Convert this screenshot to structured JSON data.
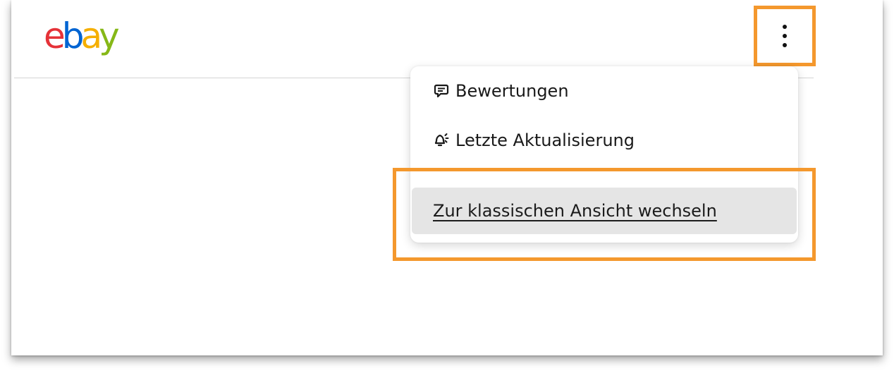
{
  "header": {
    "logo": {
      "letters": [
        "e",
        "b",
        "a",
        "y"
      ],
      "colors": [
        "#e53238",
        "#0064d2",
        "#f5af02",
        "#86b817"
      ]
    },
    "more_button_icon": "kebab-vertical-icon"
  },
  "menu": {
    "items": [
      {
        "label": "Bewertungen",
        "icon": "feedback-speech-icon"
      },
      {
        "label": "Letzte Aktualisierung",
        "icon": "announcement-icon"
      },
      {
        "label": "Zur klassischen Ansicht wechseln",
        "icon": ""
      }
    ]
  },
  "annotation": {
    "highlight_color": "#f4982d"
  }
}
